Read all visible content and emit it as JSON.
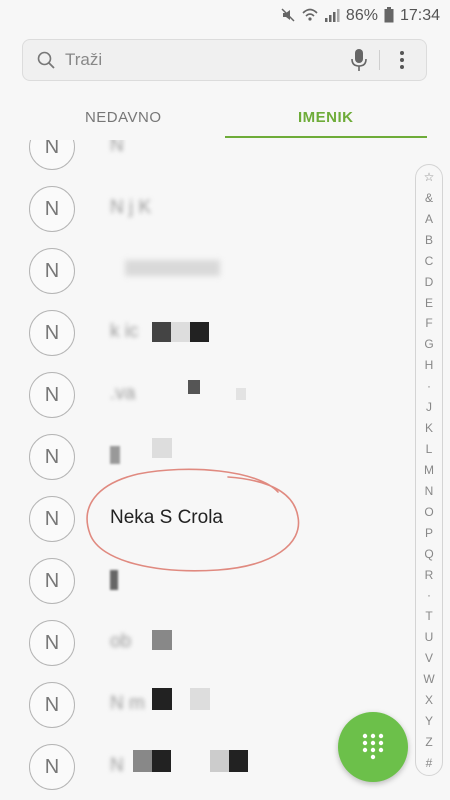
{
  "status": {
    "battery": "86%",
    "time": "17:34",
    "icons": [
      "mute-icon",
      "wifi-icon",
      "signal-icon",
      "battery-icon"
    ]
  },
  "search": {
    "placeholder": "Traži",
    "icon": "search-icon"
  },
  "tabs": [
    {
      "label": "NEDAVNO",
      "active": false
    },
    {
      "label": "IMENIK",
      "active": true
    }
  ],
  "contacts": [
    {
      "initial": "N",
      "name": "N"
    },
    {
      "initial": "N",
      "name": "N      j  K"
    },
    {
      "initial": "N",
      "name": ""
    },
    {
      "initial": "N",
      "name": "      k             ic"
    },
    {
      "initial": "N",
      "name": "           .va"
    },
    {
      "initial": "N",
      "name": ""
    },
    {
      "initial": "N",
      "name": "Neka S Crola"
    },
    {
      "initial": "N",
      "name": ""
    },
    {
      "initial": "N",
      "name": "          ob"
    },
    {
      "initial": "N",
      "name": "N     m"
    },
    {
      "initial": "N",
      "name": "N"
    }
  ],
  "alphabet_index": [
    "☆",
    "&",
    "A",
    "B",
    "C",
    "D",
    "E",
    "F",
    "G",
    "H",
    "·",
    "J",
    "K",
    "L",
    "M",
    "N",
    "O",
    "P",
    "Q",
    "R",
    "·",
    "T",
    "U",
    "V",
    "W",
    "X",
    "Y",
    "Z",
    "#"
  ],
  "colors": {
    "accent": "#6eac39",
    "fab": "#6cc04a",
    "annotation": "#e08a80"
  },
  "fab_icon": "dialpad-icon"
}
